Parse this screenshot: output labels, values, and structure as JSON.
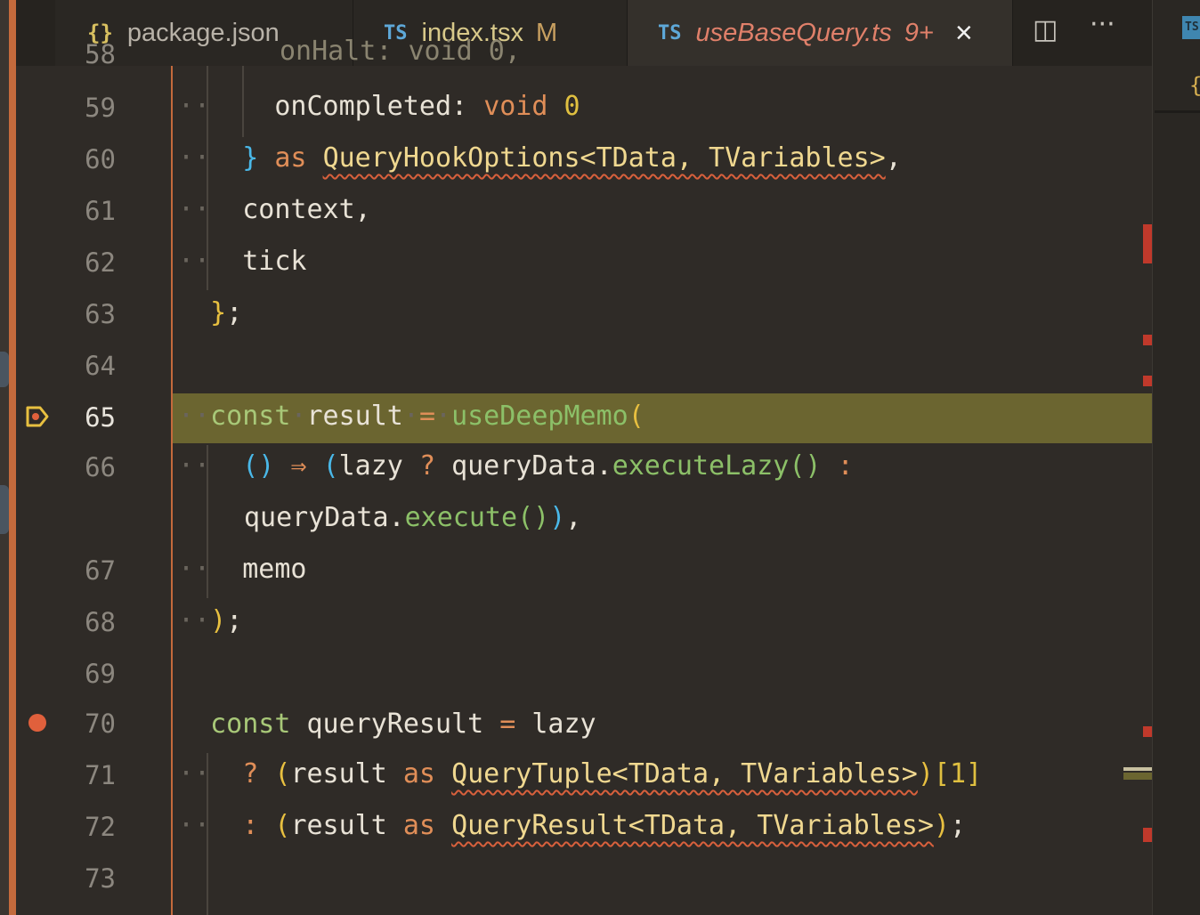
{
  "tabs": [
    {
      "icon": "{}",
      "label": "package.json",
      "badge": ""
    },
    {
      "icon": "TS",
      "label": "index.tsx",
      "badge": "M"
    },
    {
      "icon": "TS",
      "label": "useBaseQuery.ts",
      "badge": "9+"
    }
  ],
  "tab_actions": {
    "split": "◫",
    "more": "···",
    "close": "×"
  },
  "right_panel": {
    "icon": "TS",
    "brace": "{"
  },
  "line_numbers": [
    "58",
    "59",
    "60",
    "61",
    "62",
    "63",
    "64",
    "65",
    "66",
    "67",
    "68",
    "69",
    "70",
    "71",
    "72",
    "73"
  ],
  "code": {
    "l58": "onHalt: void 0,",
    "l59_prop": "onCompleted:",
    "l59_kw": "void",
    "l59_num": "0",
    "l60_brace": "}",
    "l60_as": "as",
    "l60_type": "QueryHookOptions<TData, TVariables>",
    "l60_comma": ",",
    "l61": "context,",
    "l62": "tick",
    "l63_brace": "}",
    "l63_semi": ";",
    "l65_const": "const",
    "l65_name": "result",
    "l65_eq": "=",
    "l65_fn": "useDeepMemo",
    "l65_paren": "(",
    "l66_parens": "()",
    "l66_arrow": "⇒",
    "l66_open": "(",
    "l66_lazy": "lazy",
    "l66_q": "?",
    "l66_obj": "queryData.",
    "l66_fn": "executeLazy",
    "l66_call": "()",
    "l66_colon": ":",
    "l66b_obj": "queryData.",
    "l66b_fn": "execute",
    "l66b_call": "()",
    "l66b_close": ")",
    "l66b_comma": ",",
    "l67": "memo",
    "l68_paren": ")",
    "l68_semi": ";",
    "l70_const": "const",
    "l70_name": "queryResult",
    "l70_eq": "=",
    "l70_val": "lazy",
    "l71_q": "?",
    "l71_open": "(",
    "l71_var": "result",
    "l71_as": "as",
    "l71_type": "QueryTuple<TData, TVariables>",
    "l71_close": ")",
    "l71_idx": "[1]",
    "l72_colon": ":",
    "l72_open": "(",
    "l72_var": "result",
    "l72_as": "as",
    "l72_type": "QueryResult<TData, TVariables>",
    "l72_close": ")",
    "l72_semi": ";"
  },
  "colors": {
    "keyword": "#a8c878",
    "function": "#8cc068",
    "operator": "#e08e58",
    "error": "#d8603c",
    "highlight": "#6b6530"
  }
}
